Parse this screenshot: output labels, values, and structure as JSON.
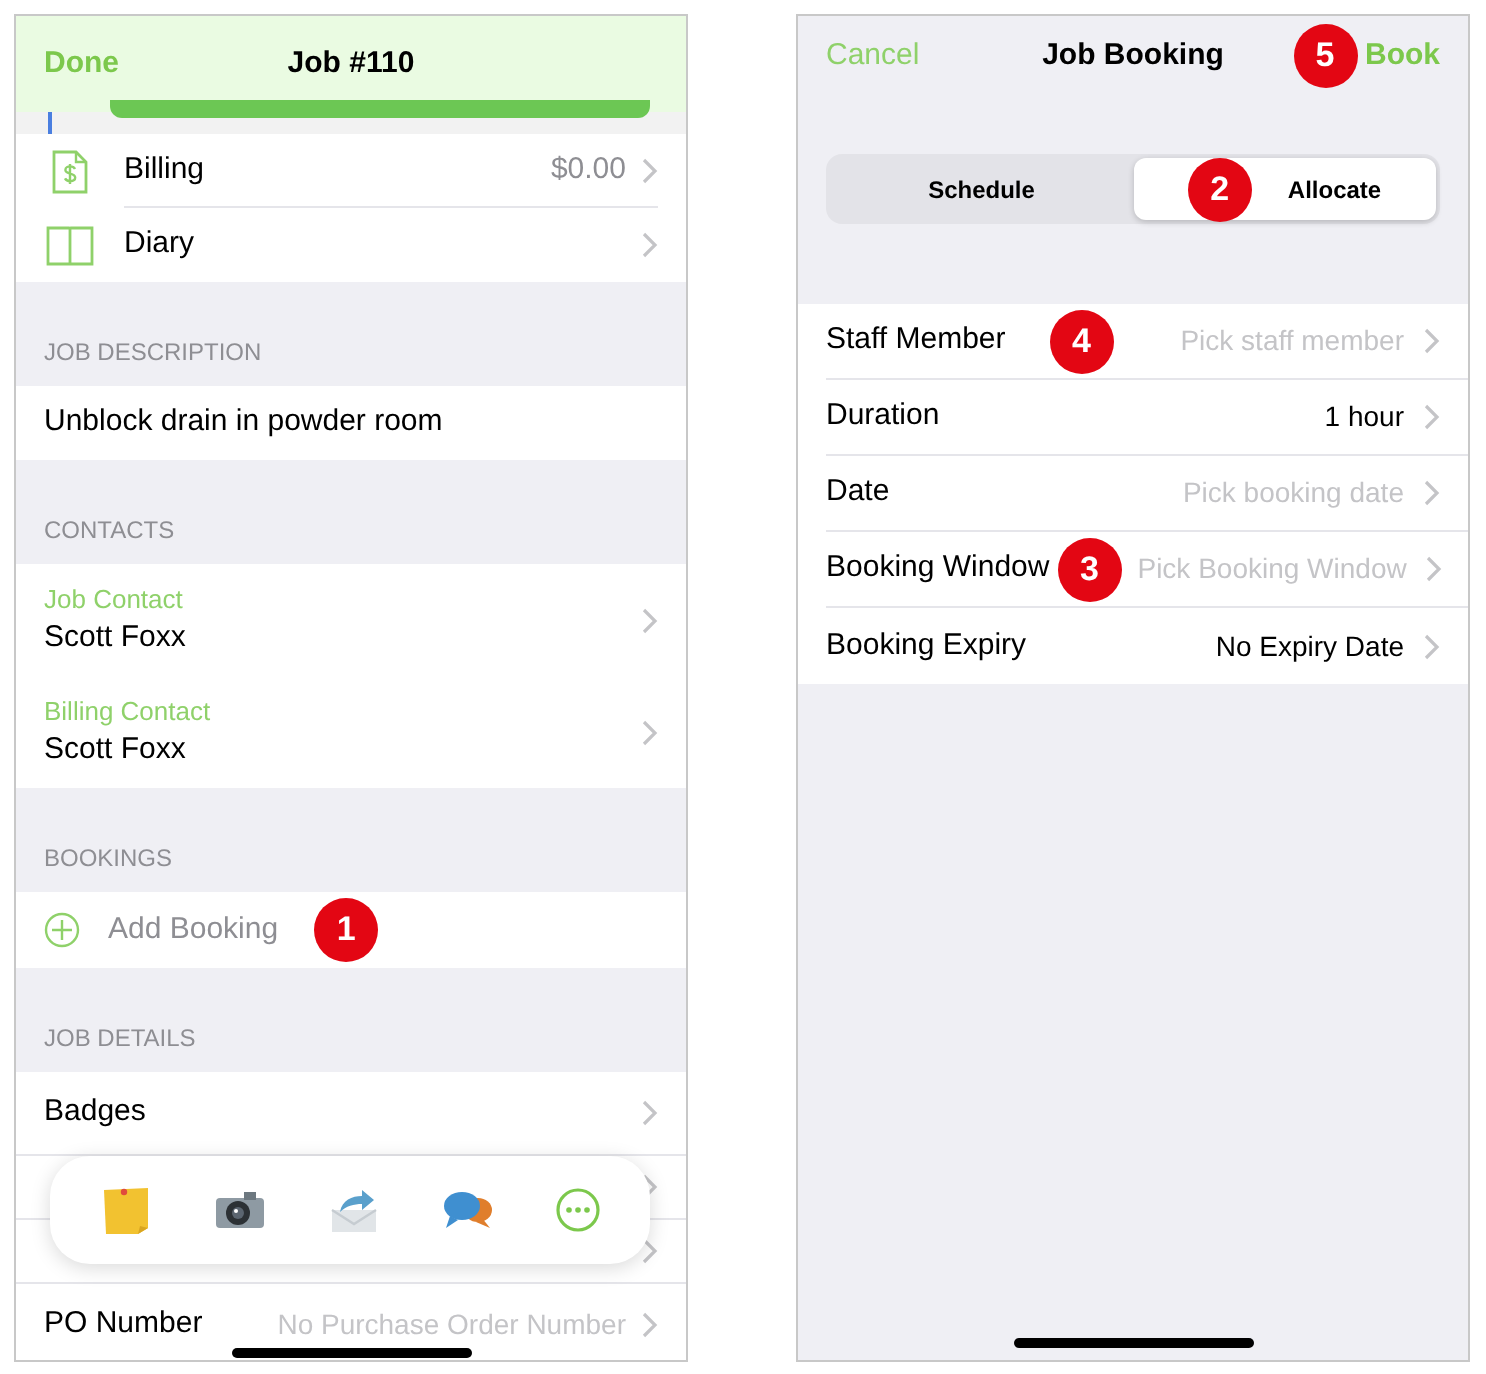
{
  "job_screen": {
    "header": {
      "back": "Done",
      "title": "Job #110"
    },
    "menu_rows": [
      {
        "kind": "billing",
        "label": "Billing",
        "value": "$0.00"
      },
      {
        "kind": "diary",
        "label": "Diary"
      }
    ],
    "sections": [
      {
        "header": "JOB DESCRIPTION",
        "rows": [
          {
            "kind": "text",
            "label": "Unblock drain in powder room"
          }
        ]
      },
      {
        "header": "CONTACTS",
        "rows": [
          {
            "kind": "contact",
            "caption": "Job Contact",
            "label": "Scott Foxx"
          },
          {
            "kind": "contact",
            "caption": "Billing Contact",
            "label": "Scott Foxx"
          }
        ]
      },
      {
        "header": "BOOKINGS",
        "rows": [
          {
            "kind": "add",
            "label": "Add Booking",
            "marker": "1"
          }
        ]
      },
      {
        "header": "JOB DETAILS",
        "rows": [
          {
            "kind": "nav",
            "label": "Badges"
          },
          {
            "kind": "covered"
          },
          {
            "kind": "covered"
          },
          {
            "kind": "nav",
            "label": "PO Number",
            "value": "No Purchase Order Number"
          }
        ]
      }
    ],
    "toolbar": [
      {
        "kind": "note"
      },
      {
        "kind": "camera"
      },
      {
        "kind": "send"
      },
      {
        "kind": "chat"
      },
      {
        "kind": "more"
      }
    ]
  },
  "booking_screen": {
    "header": {
      "cancel": "Cancel",
      "title": "Job Booking",
      "action": "Book",
      "marker": "5"
    },
    "segments": [
      {
        "label": "Schedule",
        "selected": false
      },
      {
        "label": "Allocate",
        "selected": true,
        "marker": "2"
      }
    ],
    "rows": [
      {
        "label": "Staff Member",
        "placeholder": "Pick staff member",
        "marker": "4"
      },
      {
        "label": "Duration",
        "value": "1 hour"
      },
      {
        "label": "Date",
        "placeholder": "Pick booking date"
      },
      {
        "label": "Booking Window",
        "placeholder": "Pick Booking Window",
        "marker": "3"
      },
      {
        "label": "Booking Expiry",
        "value": "No Expiry Date"
      }
    ]
  }
}
